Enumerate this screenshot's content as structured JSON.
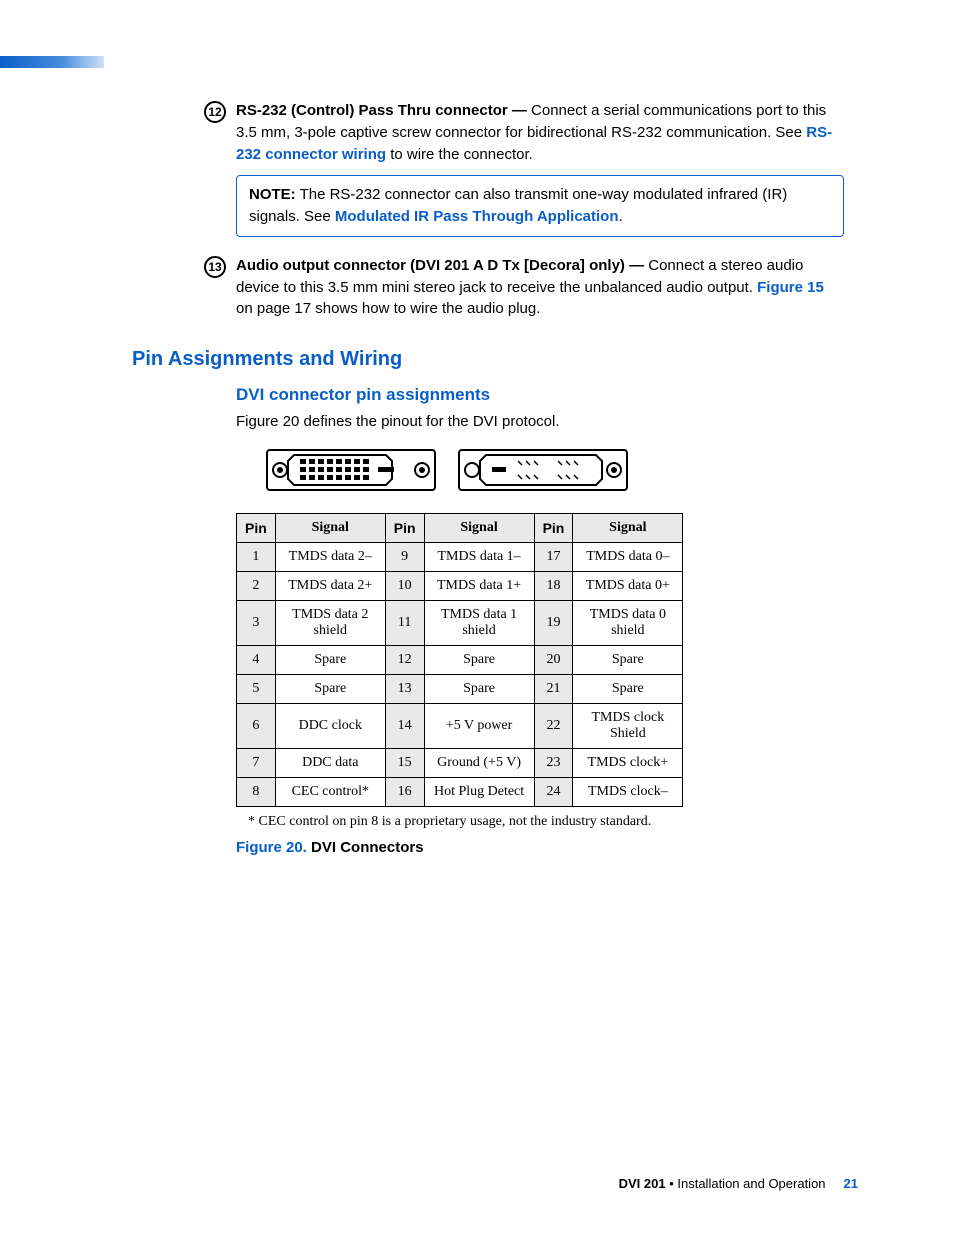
{
  "callout12": {
    "num": "12",
    "head": "RS-232 (Control) Pass Thru connector —",
    "body_a": " Connect a serial communications port to this 3.5 mm, 3-pole captive screw connector for bidirectional RS-232 communication.  See ",
    "link": "RS-232 connector wiring",
    "body_b": " to wire the connector."
  },
  "note": {
    "label": "NOTE:",
    "body_a": "  The RS-232 connector can also transmit one-way modulated infrared (IR) signals.  See ",
    "link": "Modulated IR Pass Through Application",
    "body_b": "."
  },
  "callout13": {
    "num": "13",
    "head": "Audio output connector (DVI 201 A D Tx [Decora] only) —",
    "body_a": " Connect a stereo audio device to this 3.5 mm mini stereo jack to receive the unbalanced audio output.  ",
    "link": "Figure 15",
    "body_b": " on page 17 shows how to wire the audio plug."
  },
  "headings": {
    "section": "Pin Assignments and Wiring",
    "subsection": "DVI connector pin assignments",
    "intro": "Figure 20 defines the pinout for the DVI protocol."
  },
  "table": {
    "headers": {
      "pin": "Pin",
      "signal": "Signal"
    },
    "rows": [
      {
        "p1": "1",
        "s1": "TMDS data 2–",
        "p2": "9",
        "s2": "TMDS data 1–",
        "p3": "17",
        "s3": "TMDS data 0–"
      },
      {
        "p1": "2",
        "s1": "TMDS data 2+",
        "p2": "10",
        "s2": "TMDS data 1+",
        "p3": "18",
        "s3": "TMDS data 0+"
      },
      {
        "p1": "3",
        "s1": "TMDS data 2 shield",
        "p2": "11",
        "s2": "TMDS data 1 shield",
        "p3": "19",
        "s3": "TMDS data 0 shield"
      },
      {
        "p1": "4",
        "s1": "Spare",
        "p2": "12",
        "s2": "Spare",
        "p3": "20",
        "s3": "Spare"
      },
      {
        "p1": "5",
        "s1": "Spare",
        "p2": "13",
        "s2": "Spare",
        "p3": "21",
        "s3": "Spare"
      },
      {
        "p1": "6",
        "s1": "DDC clock",
        "p2": "14",
        "s2": "+5 V power",
        "p3": "22",
        "s3": "TMDS clock Shield"
      },
      {
        "p1": "7",
        "s1": "DDC data",
        "p2": "15",
        "s2": "Ground (+5 V)",
        "p3": "23",
        "s3": "TMDS clock+"
      },
      {
        "p1": "8",
        "s1": "CEC control*",
        "p2": "16",
        "s2": "Hot Plug Detect",
        "p3": "24",
        "s3": "TMDS clock–"
      }
    ],
    "footnote": "* CEC control on pin 8 is a proprietary usage, not the industry standard."
  },
  "figure": {
    "label": "Figure 20.",
    "text": " DVI Connectors"
  },
  "footer": {
    "product": "DVI 201",
    "bullet": " • ",
    "section": "Installation and Operation",
    "page": "21"
  }
}
